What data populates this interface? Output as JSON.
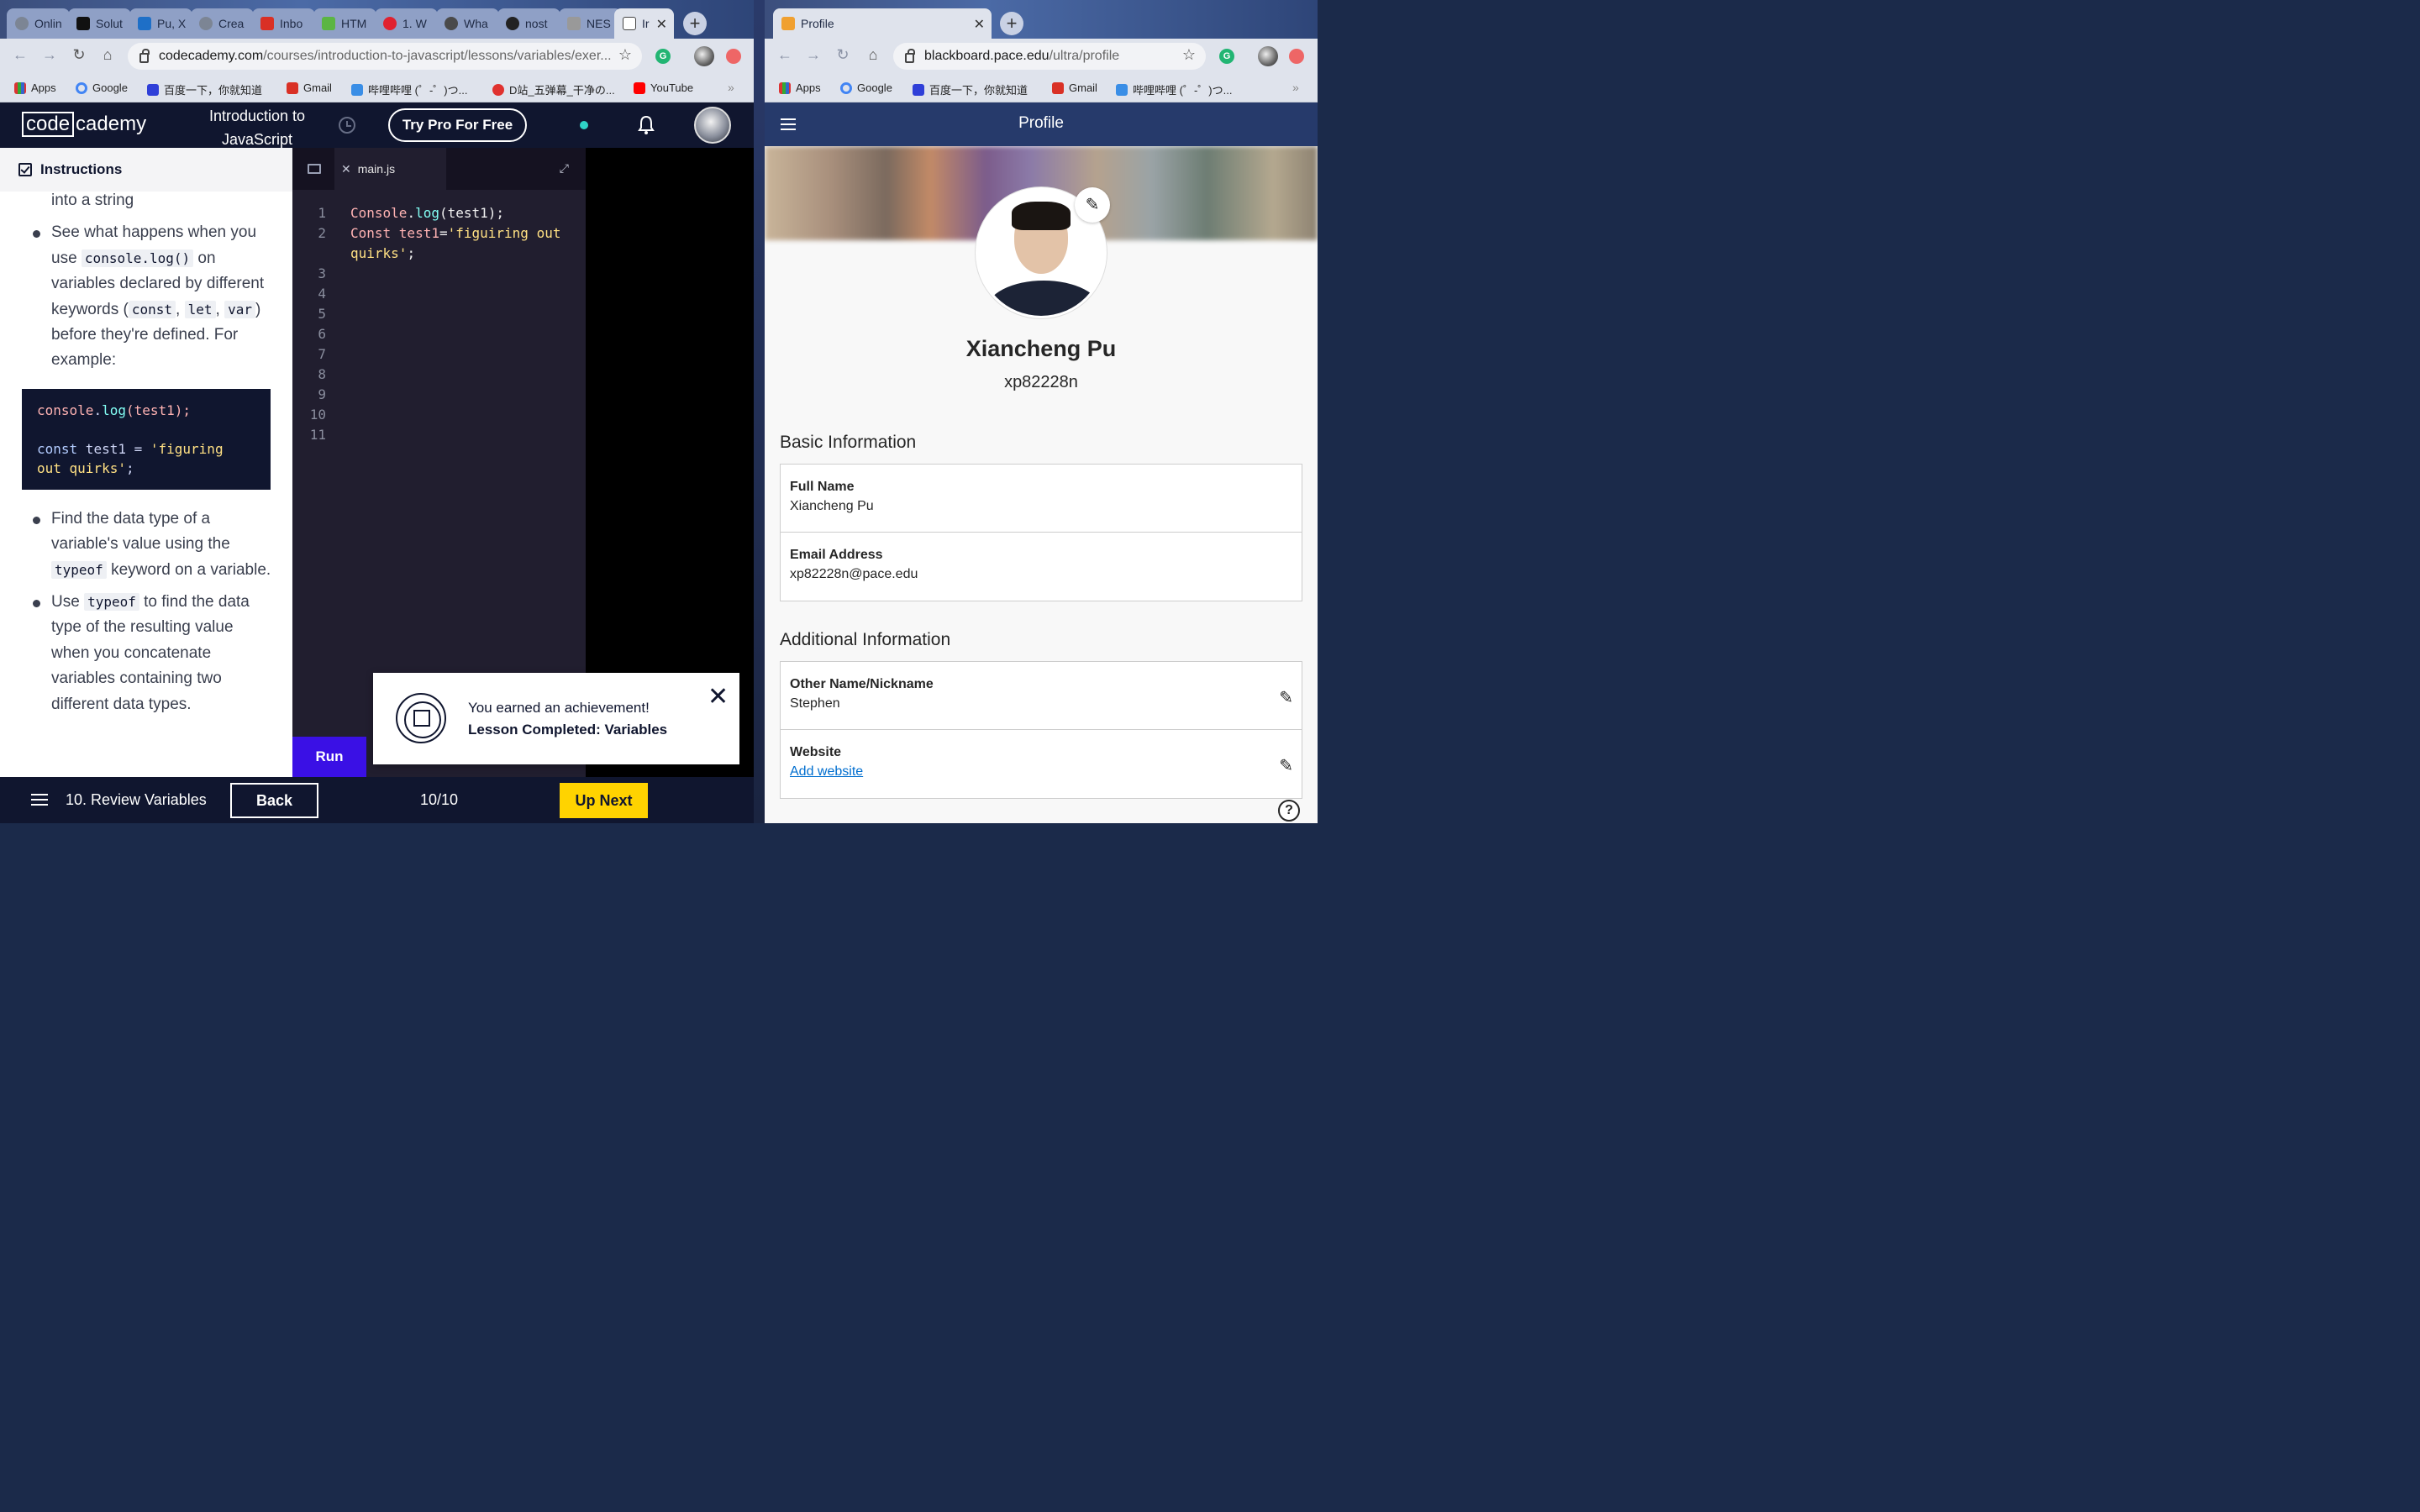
{
  "left_window": {
    "tabs": [
      {
        "label": "Onlin",
        "icon": "globe-icon"
      },
      {
        "label": "Solut",
        "icon": "s-logo-icon"
      },
      {
        "label": "Pu, X",
        "icon": "outlook-icon"
      },
      {
        "label": "Crea",
        "icon": "globe-icon"
      },
      {
        "label": "Inbo",
        "icon": "gmail-icon"
      },
      {
        "label": "HTM",
        "icon": "html-icon"
      },
      {
        "label": "1. W",
        "icon": "opera-icon"
      },
      {
        "label": "Wha",
        "icon": "grammarly-icon"
      },
      {
        "label": "nost",
        "icon": "github-icon"
      },
      {
        "label": "NES",
        "icon": "nes-icon"
      },
      {
        "label": "Ir",
        "icon": "page-icon",
        "active": true
      }
    ],
    "url_host": "codecademy.com",
    "url_path": "/courses/introduction-to-javascript/lessons/variables/exer...",
    "bookmarks": [
      "Apps",
      "Google",
      "百度一下，你就知道",
      "Gmail",
      "哔哩哔哩 (゜-゜)つ...",
      "D站_五弹幕_干净の...",
      "YouTube"
    ],
    "bookmarks_more": "»"
  },
  "codecademy": {
    "logo_boxed": "code",
    "logo_rest": "cademy",
    "course_title": "Introduction to JavaScript",
    "pro_button": "Try Pro For Free",
    "instructions_header": "Instructions",
    "instructions_top_text": "into a string",
    "bullet1_a": "See what happens when you use ",
    "bullet1_code1": "console.log()",
    "bullet1_b": " on variables declared by different keywords (",
    "bullet1_code2": "const",
    "bullet1_sep1": ", ",
    "bullet1_code3": "let",
    "bullet1_sep2": ", ",
    "bullet1_code4": "var",
    "bullet1_c": ") before they're defined. For example:",
    "codeblock": {
      "l1_var": "console",
      "l1_dot": ".",
      "l1_fn": "log",
      "l1_rest": "(test1);",
      "l2_kw": "const",
      "l2_rest": " test1 = ",
      "l2_str": "'figuring out quirks'",
      "l2_end": ";"
    },
    "bullet2_a": "Find the data type of a variable's value using the ",
    "bullet2_code": "typeof",
    "bullet2_b": " keyword on a variable.",
    "bullet3_a": "Use ",
    "bullet3_code": "typeof",
    "bullet3_b": " to find the data type of the resulting value when you concatenate variables containing two different data types.",
    "editor_file": "main.js",
    "code_lines": [
      {
        "num": "1",
        "parts": [
          {
            "t": "Console",
            "c": "var"
          },
          {
            "t": ".",
            "c": "plain"
          },
          {
            "t": "log",
            "c": "fn"
          },
          {
            "t": "(test1);",
            "c": "plain"
          }
        ]
      },
      {
        "num": "2",
        "parts": [
          {
            "t": "Const test1",
            "c": "var"
          },
          {
            "t": "=",
            "c": "plain"
          },
          {
            "t": "'figuiring out",
            "c": "str"
          }
        ]
      },
      {
        "num": "",
        "parts": [
          {
            "t": "quirks'",
            "c": "str"
          },
          {
            "t": ";",
            "c": "plain"
          }
        ]
      },
      {
        "num": "3",
        "parts": []
      },
      {
        "num": "4",
        "parts": []
      },
      {
        "num": "5",
        "parts": []
      },
      {
        "num": "6",
        "parts": []
      },
      {
        "num": "7",
        "parts": []
      },
      {
        "num": "8",
        "parts": []
      },
      {
        "num": "9",
        "parts": []
      },
      {
        "num": "10",
        "parts": []
      },
      {
        "num": "11",
        "parts": []
      }
    ],
    "run_button": "Run",
    "footer": {
      "lesson": "10. Review Variables",
      "back": "Back",
      "progress": "10/10",
      "next": "Up Next"
    },
    "toast": {
      "line1": "You earned an achievement!",
      "line2": "Lesson Completed: Variables"
    },
    "colors": {
      "navy": "#10162f",
      "run": "#3a10e5",
      "next": "#ffd300"
    }
  },
  "right_window": {
    "tab_label": "Profile",
    "url_host": "blackboard.pace.edu",
    "url_path": "/ultra/profile",
    "bookmarks": [
      "Apps",
      "Google",
      "百度一下，你就知道",
      "Gmail",
      "哔哩哔哩 (゜-゜)つ..."
    ],
    "bookmarks_more": "»"
  },
  "blackboard": {
    "header_title": "Profile",
    "name": "Xiancheng Pu",
    "username": "xp82228n",
    "basic_section": "Basic Information",
    "full_name_label": "Full Name",
    "full_name_value": "Xiancheng Pu",
    "email_label": "Email Address",
    "email_value": "xp82228n@pace.edu",
    "additional_section": "Additional Information",
    "nickname_label": "Other Name/Nickname",
    "nickname_value": "Stephen",
    "website_label": "Website",
    "website_link": "Add website",
    "help_glyph": "?",
    "colors": {
      "header": "#263a6b",
      "link": "#006ecf"
    }
  }
}
